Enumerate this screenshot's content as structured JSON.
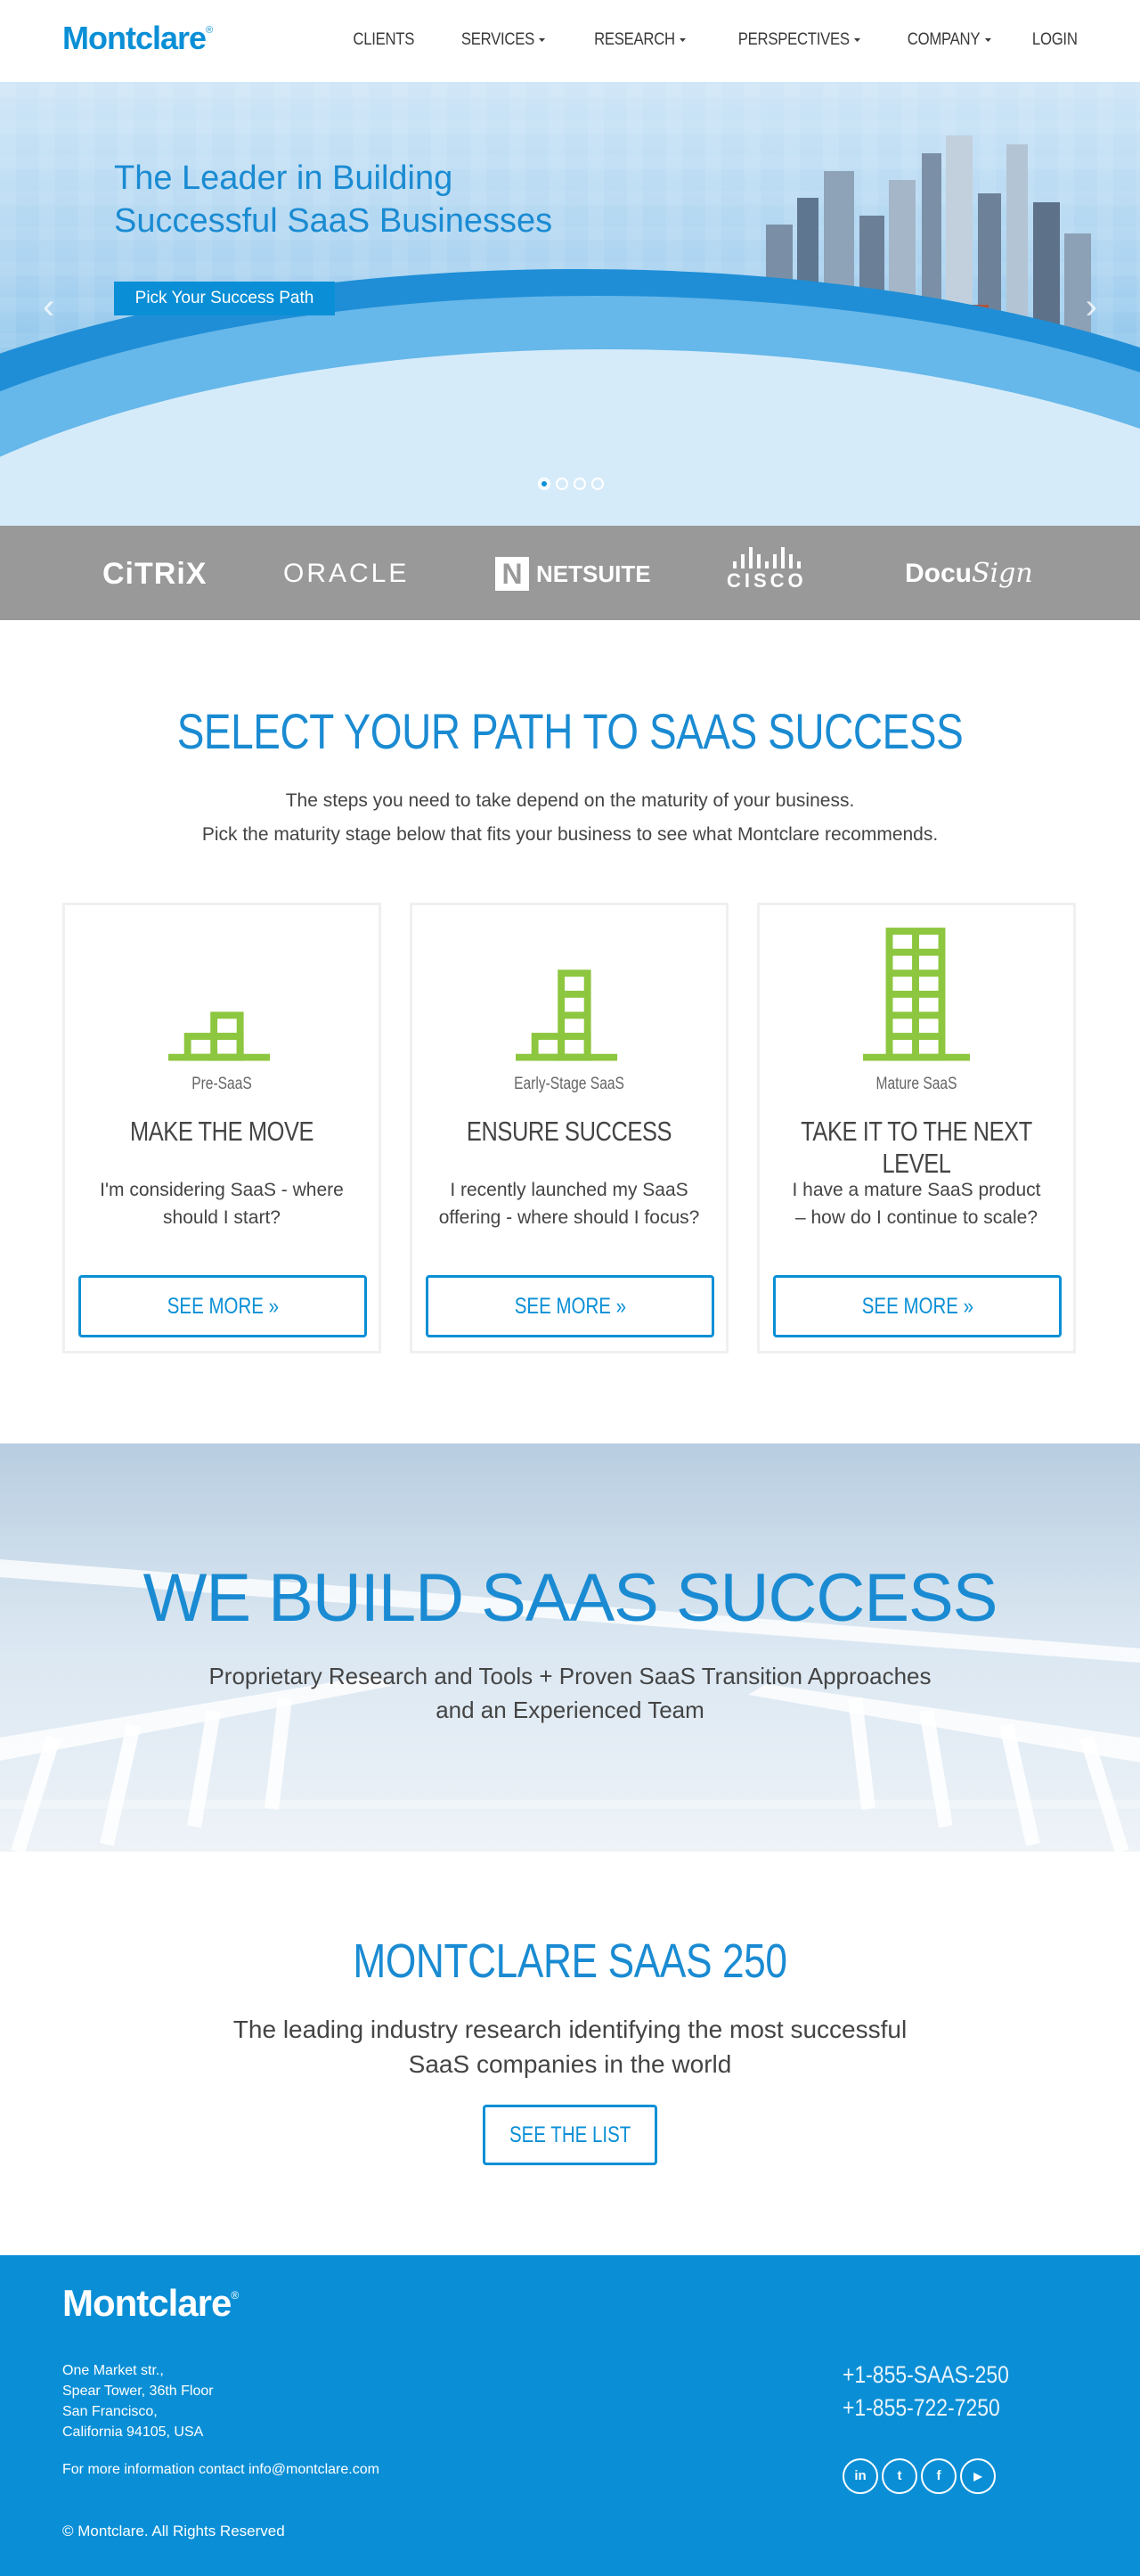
{
  "header": {
    "logo": "Montclare",
    "logo_mark": "®",
    "nav": [
      {
        "label": "CLIENTS",
        "dropdown": false
      },
      {
        "label": "SERVICES",
        "dropdown": true
      },
      {
        "label": "RESEARCH",
        "dropdown": true
      },
      {
        "label": "PERSPECTIVES",
        "dropdown": true
      },
      {
        "label": "COMPANY",
        "dropdown": true
      },
      {
        "label": "LOGIN",
        "dropdown": false
      }
    ]
  },
  "hero": {
    "title_line1": "The Leader in Building",
    "title_line2": "Successful SaaS Businesses",
    "cta": "Pick Your Success Path",
    "slides": 4,
    "active_slide": 1,
    "prev_icon": "chevron-left-icon",
    "next_icon": "chevron-right-icon"
  },
  "clients": {
    "citrix": "CiTRiX",
    "oracle": "ORACLE",
    "netsuite_mark": "N",
    "netsuite": "NETSUITE",
    "cisco": "CISCO",
    "docusign_a": "Docu",
    "docusign_b": "Sign"
  },
  "path": {
    "title": "SELECT YOUR PATH TO SAAS SUCCESS",
    "sub1": "The steps you need to take depend on the maturity of your business.",
    "sub2": "Pick the maturity stage below that fits your business to see what Montclare recommends.",
    "cards": [
      {
        "stage": "Pre-SaaS",
        "heading": "MAKE THE MOVE",
        "text": "I'm considering SaaS - where should I start?",
        "button": "SEE MORE"
      },
      {
        "stage": "Early-Stage SaaS",
        "heading": "ENSURE SUCCESS",
        "text": "I recently launched my SaaS offering - where should I focus?",
        "button": "SEE MORE"
      },
      {
        "stage": "Mature SaaS",
        "heading": "TAKE IT TO THE NEXT LEVEL",
        "text": "I have a mature SaaS product – how do I continue to scale?",
        "button": "SEE MORE"
      }
    ]
  },
  "build": {
    "title": "WE BUILD SAAS SUCCESS",
    "sub1": "Proprietary Research and Tools + Proven SaaS Transition Approaches",
    "sub2": "and an Experienced Team"
  },
  "saas250": {
    "title": "MONTCLARE SAAS 250",
    "sub1": "The leading industry research identifying the most successful",
    "sub2": "SaaS companies in the world",
    "button": "SEE THE LIST"
  },
  "footer": {
    "logo": "Montclare",
    "logo_mark": "®",
    "address": [
      "One Market str.,",
      "Spear Tower, 36th Floor",
      "San Francisco,",
      "California 94105, USA"
    ],
    "contact": "For more information contact info@montclare.com",
    "phone1": "+1-855-SAAS-250",
    "phone2": "+1-855-722-7250",
    "social": [
      {
        "label": "in",
        "icon": "linkedin-icon"
      },
      {
        "label": "t",
        "icon": "twitter-icon"
      },
      {
        "label": "f",
        "icon": "facebook-icon"
      },
      {
        "label": "▶",
        "icon": "youtube-icon"
      }
    ],
    "copyright": "© Montclare. All Rights Reserved"
  },
  "colors": {
    "brand": "#0a8fd6",
    "title_blue": "#1a8bd2",
    "building_green": "#8dc63f",
    "logo_strip": "#999999"
  }
}
